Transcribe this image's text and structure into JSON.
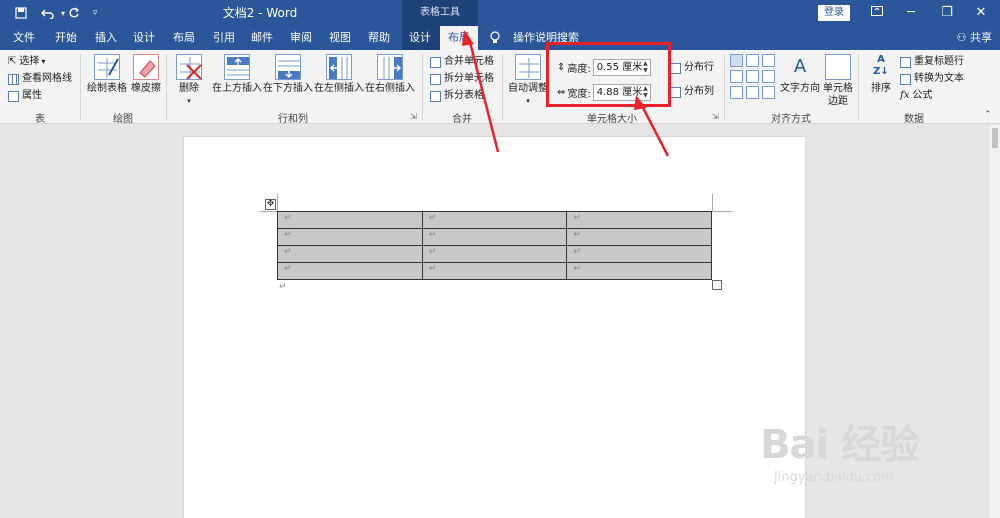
{
  "titlebar": {
    "doc_title": "文档2  -  Word",
    "context_tools": "表格工具",
    "login": "登录",
    "save_icon": "save-icon",
    "undo_icon": "undo-icon",
    "redo_icon": "redo-icon"
  },
  "tabs": [
    "文件",
    "开始",
    "插入",
    "设计",
    "布局",
    "引用",
    "邮件",
    "审阅",
    "视图",
    "帮助",
    "设计",
    "布局"
  ],
  "search_label": "操作说明搜索",
  "share_label": "共享",
  "ribbon": {
    "table_group": {
      "label": "表",
      "select": "选择",
      "gridlines": "查看网格线",
      "properties": "属性"
    },
    "draw_group": {
      "label": "绘图",
      "draw_table": "绘制表格",
      "eraser": "橡皮擦"
    },
    "rows_cols_group": {
      "label": "行和列",
      "delete": "删除",
      "insert_above": "在上方插入",
      "insert_below": "在下方插入",
      "insert_left": "在左侧插入",
      "insert_right": "在右侧插入"
    },
    "merge_group": {
      "label": "合并",
      "merge_cells": "合并单元格",
      "split_cells": "拆分单元格",
      "split_table": "拆分表格"
    },
    "cell_size_group": {
      "label": "单元格大小",
      "autofit": "自动调整",
      "height_label": "高度:",
      "height_value": "0.55 厘米",
      "width_label": "宽度:",
      "width_value": "4.88 厘米",
      "distribute_rows": "分布行",
      "distribute_cols": "分布列"
    },
    "alignment_group": {
      "label": "对齐方式",
      "text_direction": "文字方向",
      "cell_margins_1": "单元格",
      "cell_margins_2": "边距"
    },
    "data_group": {
      "label": "数据",
      "sort": "排序",
      "repeat_header": "重复标题行",
      "convert_to_text": "转换为文本",
      "formula": "公式"
    }
  },
  "document": {
    "table_rows": 4,
    "table_cols": 3,
    "cell_mark": "↵",
    "move_handle": "✥"
  },
  "watermark": {
    "logo": "Bai 经验",
    "url": "jingyan.baidu.com"
  }
}
